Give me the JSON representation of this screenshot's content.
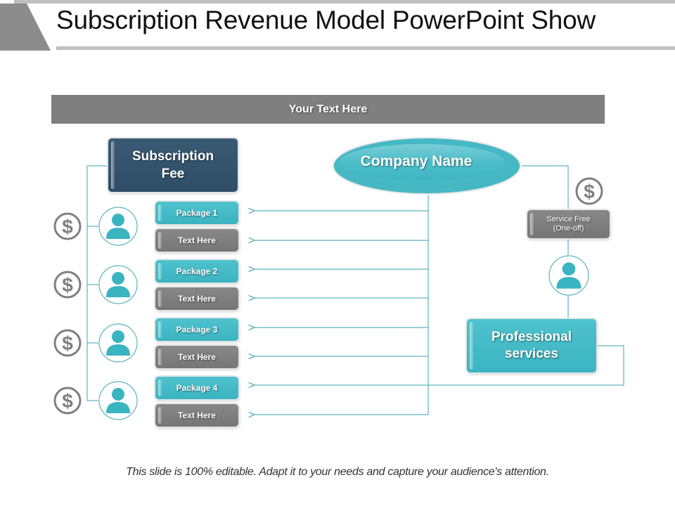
{
  "header": {
    "title": "Subscription Revenue Model PowerPoint Show"
  },
  "banner": {
    "text": "Your Text Here"
  },
  "subscription_fee": {
    "label_line1": "Subscription",
    "label_line2": "Fee"
  },
  "company": {
    "label": "Company Name"
  },
  "packages": [
    {
      "label": "Package 1",
      "detail": "Text Here"
    },
    {
      "label": "Package 2",
      "detail": "Text Here"
    },
    {
      "label": "Package 3",
      "detail": "Text Here"
    },
    {
      "label": "Package 4",
      "detail": "Text Here"
    }
  ],
  "service_fee": {
    "line1": "Service Free",
    "line2": "(One-off)"
  },
  "professional_services": {
    "line1": "Professional",
    "line2": "services"
  },
  "icons": {
    "currency": "dollar-circle-icon",
    "user": "user-circle-icon"
  },
  "colors": {
    "teal": "#3bb4c1",
    "navy": "#2e4d66",
    "gray": "#7f7f7f",
    "line": "#5fb3bd"
  },
  "footer": {
    "text": "This slide is 100% editable. Adapt it to your needs and capture your audience's attention."
  }
}
